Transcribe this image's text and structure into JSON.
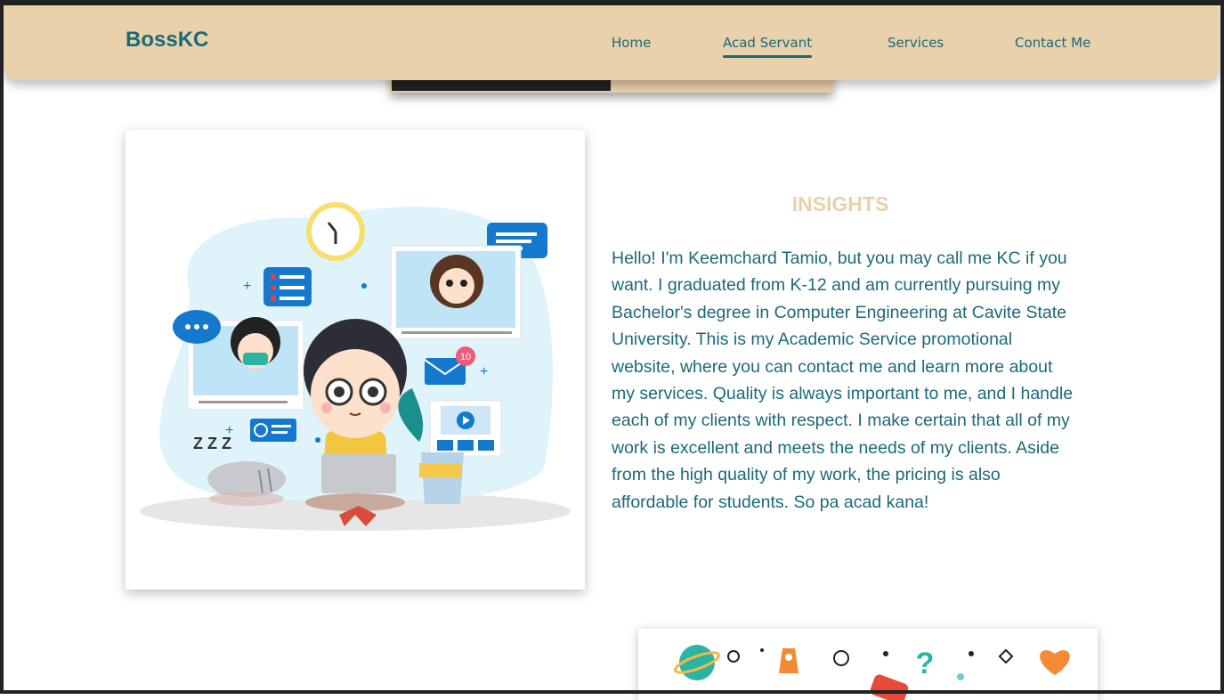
{
  "nav": {
    "brand": "BossKC",
    "links": [
      "Home",
      "Acad Servant",
      "Services",
      "Contact Me"
    ],
    "active": "Acad Servant"
  },
  "about": {
    "title": "INSIGHTS",
    "text": "Hello! I'm Keemchard Tamio, but you may call me KC if you want. I graduated from K-12 and am currently pursuing my Bachelor's degree in Computer Engineering at Cavite State University. This is my Academic Service promotional website, where you can contact me and learn more about my services. Quality is always important to me, and I handle each of my clients with respect. I make certain that all of my work is excellent and meets the needs of my clients. Aside from the high quality of my work, the pricing is also affordable for students. So pa acad kana!"
  },
  "illustration": {
    "notification_count": "10",
    "sleep_text": "Z Z Z"
  },
  "colors": {
    "accent": "#1b6a78",
    "nav_bg": "#e8d1ab",
    "title": "#e8d1ab"
  }
}
